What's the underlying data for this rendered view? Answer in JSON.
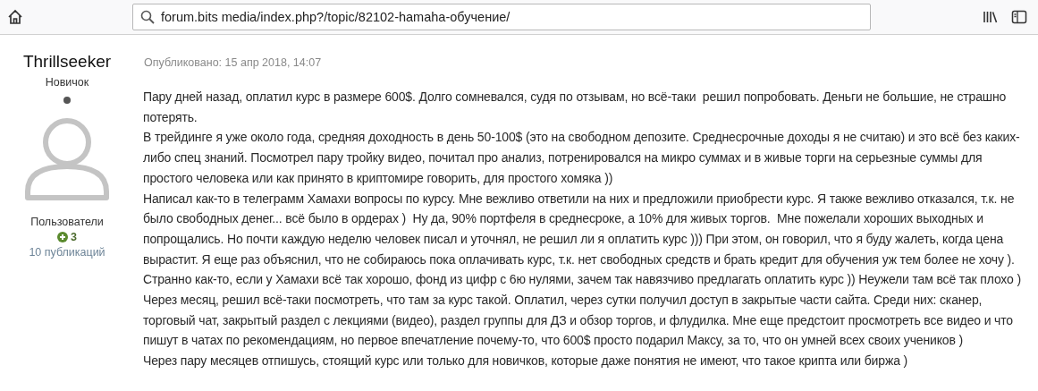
{
  "toolbar": {
    "url": "forum.bits media/index.php?/topic/82102-hamaha-обучение/"
  },
  "author": {
    "name": "Thrillseeker",
    "rank": "Новичок",
    "group": "Пользователи",
    "reputation": "3",
    "posts": "10 публикаций"
  },
  "post": {
    "published": "Опубликовано: 15 апр 2018, 14:07",
    "paragraphs": [
      "Пару дней назад, оплатил курс в размере 600$. Долго сомневался, судя по отзывам, но всё-таки  решил попробовать. Деньги не большие, не страшно потерять.",
      "В трейдинге я уже около года, средняя доходность в день 50-100$ (это на свободном депозите. Среднесрочные доходы я не считаю) и это всё без каких-либо спец знаний. Посмотрел пару тройку видео, почитал про анализ, потренировался на микро суммах и в живые торги на серьезные суммы для простого человека или как принято в криптомире говорить, для простого хомяка ))",
      "Написал как-то в телеграмм Хамахи вопросы по курсу. Мне вежливо ответили на них и предложили приобрести курс. Я также вежливо отказался, т.к. не было свободных денег... всё было в ордерах )  Ну да, 90% портфеля в среднесроке, а 10% для живых торгов.  Мне пожелали хороших выходных и попрощались. Но почти каждую неделю человек писал и уточнял, не решил ли я оплатить курс ))) При этом, он говорил, что я буду жалеть, когда цена вырастит. Я еще раз объяснил, что не собираюсь пока оплачивать курс, т.к. нет свободных средств и брать кредит для обучения уж тем более не хочу ). Странно как-то, если у Хамахи всё так хорошо, фонд из цифр с 6ю нулями, зачем так навязчиво предлагать оплатить курс )) Неужели там всё так плохо ) Через месяц, решил всё-таки посмотреть, что там за курс такой. Оплатил, через сутки получил доступ в закрытые части сайта. Среди них: сканер, торговый чат, закрытый раздел с лекциями (видео), раздел группы для ДЗ и обзор торгов, и флудилка. Мне еще предстоит просмотреть все видео и что пишут в чатах по рекомендациям, но первое впечатление почему-то, что 600$ просто подарил Максу, за то, что он умней всех своих учеников )",
      "Через пару месяцев отпишусь, стоящий курс или только для новичков, которые даже понятия не имеют, что такое крипта или биржа )"
    ]
  }
}
